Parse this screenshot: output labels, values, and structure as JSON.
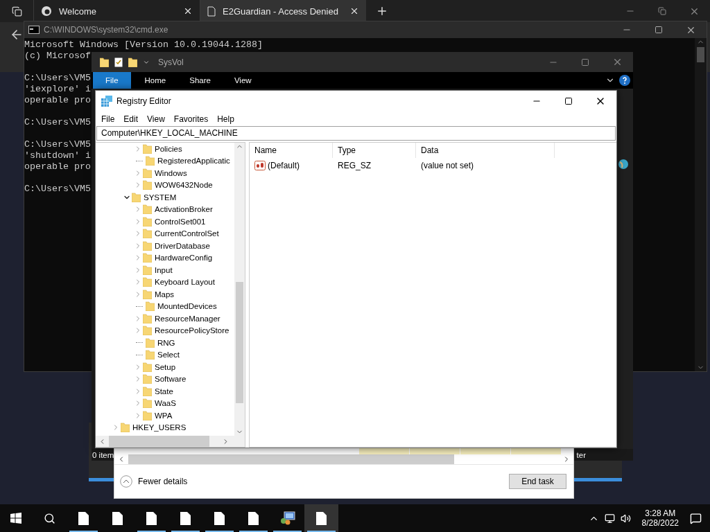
{
  "browser": {
    "tabs": [
      {
        "title": "Welcome",
        "selected": false
      },
      {
        "title": "E2Guardian - Access Denied",
        "selected": true
      }
    ]
  },
  "cmd": {
    "title": "C:\\WINDOWS\\system32\\cmd.exe",
    "blocks": [
      [
        "Microsoft Windows [Version 10.0.19044.1288]",
        "(c) Microsof"
      ],
      [
        "C:\\Users\\VM5",
        "'iexplore' i",
        "operable pro"
      ],
      [
        "C:\\Users\\VM5"
      ],
      [
        "C:\\Users\\VM5",
        "'shutdown' i",
        "operable pro"
      ],
      [
        "C:\\Users\\VM5"
      ]
    ]
  },
  "explorer": {
    "title": "SysVol",
    "ribbon_tabs": [
      {
        "label": "File",
        "selected": true
      },
      {
        "label": "Home",
        "selected": false
      },
      {
        "label": "Share",
        "selected": false
      },
      {
        "label": "View",
        "selected": false
      }
    ],
    "status": "0 item",
    "status_right": "ter"
  },
  "task_manager": {
    "details_toggle": "Fewer details",
    "end_task": "End task"
  },
  "registry": {
    "title": "Registry Editor",
    "menu": [
      "File",
      "Edit",
      "View",
      "Favorites",
      "Help"
    ],
    "address": "Computer\\HKEY_LOCAL_MACHINE",
    "tree": [
      {
        "children": [
          {
            "children": [
              {
                "label": "Policies",
                "expandable": true,
                "expanded": false
              },
              {
                "label": "RegisteredApplicatic",
                "expandable": false
              },
              {
                "label": "Windows",
                "expandable": true,
                "expanded": false
              },
              {
                "label": "WOW6432Node",
                "expandable": true,
                "expanded": false
              }
            ]
          },
          {
            "label": "SYSTEM",
            "expandable": true,
            "expanded": true,
            "children": [
              {
                "label": "ActivationBroker",
                "expandable": true,
                "expanded": false
              },
              {
                "label": "ControlSet001",
                "expandable": true,
                "expanded": false
              },
              {
                "label": "CurrentControlSet",
                "expandable": true,
                "expanded": false
              },
              {
                "label": "DriverDatabase",
                "expandable": true,
                "expanded": false
              },
              {
                "label": "HardwareConfig",
                "expandable": true,
                "expanded": false
              },
              {
                "label": "Input",
                "expandable": true,
                "expanded": false
              },
              {
                "label": "Keyboard Layout",
                "expandable": true,
                "expanded": false
              },
              {
                "label": "Maps",
                "expandable": true,
                "expanded": false
              },
              {
                "label": "MountedDevices",
                "expandable": false
              },
              {
                "label": "ResourceManager",
                "expandable": true,
                "expanded": false
              },
              {
                "label": "ResourcePolicyStore",
                "expandable": true,
                "expanded": false
              },
              {
                "label": "RNG",
                "expandable": false
              },
              {
                "label": "Select",
                "expandable": false
              },
              {
                "label": "Setup",
                "expandable": true,
                "expanded": false
              },
              {
                "label": "Software",
                "expandable": true,
                "expanded": false
              },
              {
                "label": "State",
                "expandable": true,
                "expanded": false
              },
              {
                "label": "WaaS",
                "expandable": true,
                "expanded": false
              },
              {
                "label": "WPA",
                "expandable": true,
                "expanded": false
              }
            ]
          }
        ]
      },
      {
        "label": "HKEY_USERS",
        "expandable": true,
        "expanded": false
      }
    ],
    "columns": [
      "Name",
      "Type",
      "Data"
    ],
    "values": [
      {
        "name": "(Default)",
        "type": "REG_SZ",
        "data": "(value not set)"
      }
    ]
  },
  "taskbar": {
    "apps": [
      {
        "kind": "file",
        "running": true,
        "selected": false
      },
      {
        "kind": "file",
        "running": false,
        "selected": false
      },
      {
        "kind": "file",
        "running": true,
        "selected": false
      },
      {
        "kind": "file",
        "running": true,
        "selected": false
      },
      {
        "kind": "file",
        "running": true,
        "selected": false
      },
      {
        "kind": "file",
        "running": true,
        "selected": false
      },
      {
        "kind": "network",
        "running": true,
        "selected": false
      },
      {
        "kind": "file",
        "running": true,
        "selected": true
      }
    ],
    "time": "3:28 AM",
    "date": "8/28/2022"
  }
}
